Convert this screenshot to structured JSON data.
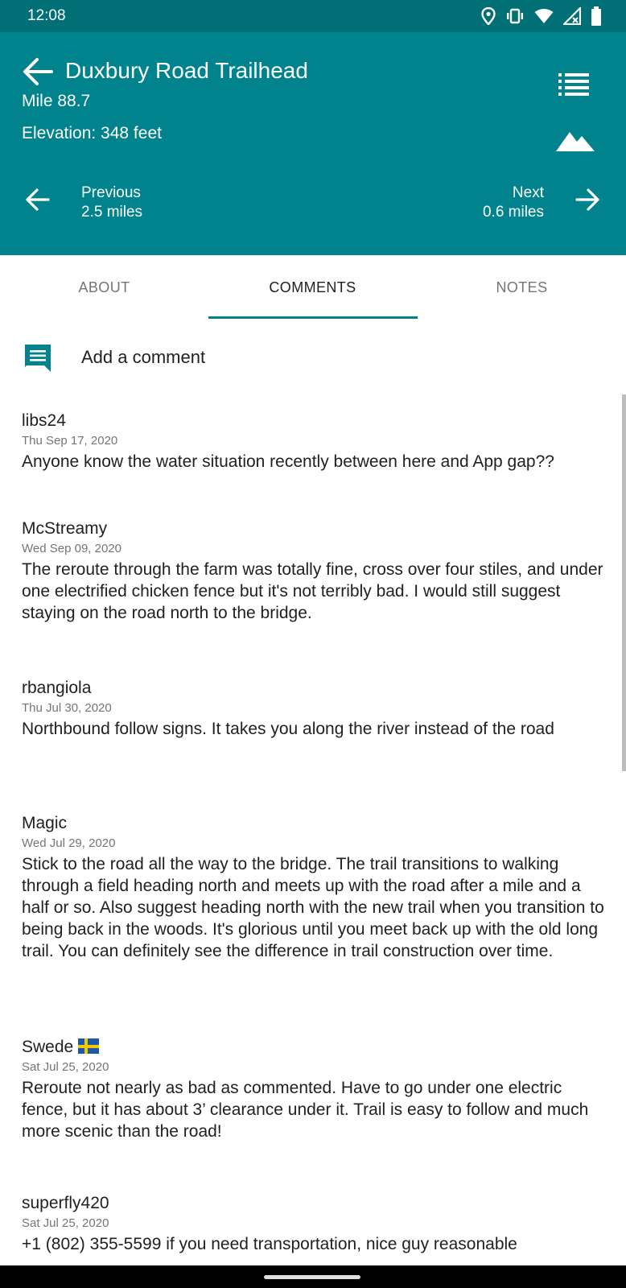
{
  "status_bar": {
    "time": "12:08",
    "icons": [
      "location-icon",
      "vibrate-icon",
      "wifi-icon",
      "signal-icon",
      "battery-icon"
    ]
  },
  "header": {
    "title": "Duxbury Road Trailhead",
    "mile": "Mile 88.7",
    "elevation": "Elevation: 348 feet",
    "previous": {
      "label": "Previous",
      "distance": "2.5 miles"
    },
    "next": {
      "label": "Next",
      "distance": "0.6 miles"
    },
    "icons": [
      "back-arrow-icon",
      "list-icon",
      "mountain-icon"
    ]
  },
  "tabs": [
    {
      "label": "ABOUT",
      "active": false
    },
    {
      "label": "COMMENTS",
      "active": true
    },
    {
      "label": "NOTES",
      "active": false
    }
  ],
  "add_comment": {
    "label": "Add a comment",
    "icon": "comment-icon"
  },
  "comments": [
    {
      "author": "libs24",
      "date": "Thu Sep 17, 2020",
      "text": "Anyone know the water situation recently between here and App gap??"
    },
    {
      "author": "McStreamy",
      "date": "Wed Sep 09, 2020",
      "text": "The reroute through the farm was totally fine, cross over four stiles, and under one electrified chicken fence but it's not terribly bad. I would still suggest staying on the road north to the bridge."
    },
    {
      "author": "rbangiola",
      "date": "Thu Jul 30, 2020",
      "text": "Northbound follow signs. It takes you along the river instead of the road"
    },
    {
      "author": "Magic",
      "date": "Wed Jul 29, 2020",
      "text": "Stick to the road all the way to the bridge. The trail transitions to walking through a field heading north and meets up with the road after a mile and a half or so. Also suggest heading north with the new trail when you transition to being back in the woods. It's glorious until you meet back up with the old long trail. You can definitely see the difference in trail construction over time."
    },
    {
      "author": "Swede",
      "author_flag": "sweden-flag",
      "date": "Sat Jul 25, 2020",
      "text": "Reroute not nearly as bad as commented. Have to go under one electric fence, but it has about 3’ clearance under it. Trail is easy to follow and much more scenic than the road!"
    },
    {
      "author": "superfly420",
      "date": "Sat Jul 25, 2020",
      "text": "+1 (802) 355-5599 if you need transportation, nice guy reasonable"
    }
  ],
  "colors": {
    "status_bar": "#006f76",
    "header": "#00838c",
    "accent": "#00838c",
    "text_primary": "#212121",
    "text_secondary": "#757575"
  }
}
